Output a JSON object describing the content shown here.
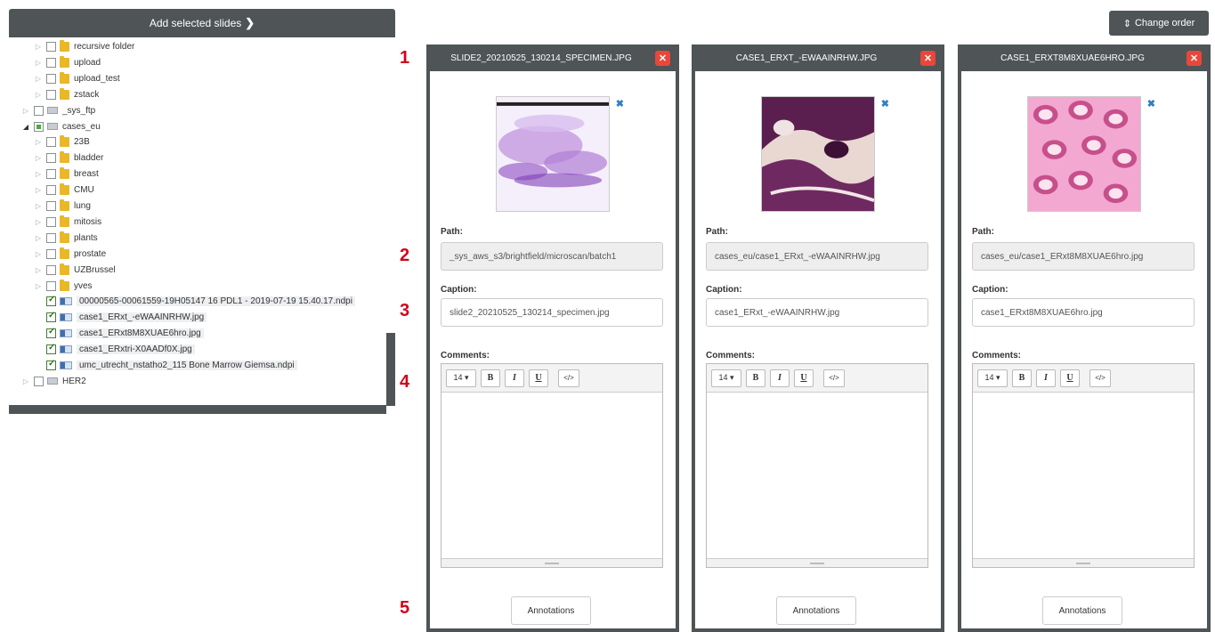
{
  "add_button": {
    "label": "Add selected slides",
    "icon": "chevron-right-icon"
  },
  "change_order": {
    "label": "Change order",
    "icon": "sort-icon"
  },
  "tree": [
    {
      "label": "recursive folder",
      "kind": "folder",
      "level": 2,
      "checked": "no",
      "toggle": "closed"
    },
    {
      "label": "upload",
      "kind": "folder",
      "level": 2,
      "checked": "no",
      "toggle": "closed"
    },
    {
      "label": "upload_test",
      "kind": "folder",
      "level": 2,
      "checked": "no",
      "toggle": "closed"
    },
    {
      "label": "zstack",
      "kind": "folder",
      "level": 2,
      "checked": "no",
      "toggle": "closed"
    },
    {
      "label": "_sys_ftp",
      "kind": "drive",
      "level": 1,
      "checked": "no",
      "toggle": "closed"
    },
    {
      "label": "cases_eu",
      "kind": "drive",
      "level": 1,
      "checked": "partial",
      "toggle": "open"
    },
    {
      "label": "23B",
      "kind": "folder",
      "level": 2,
      "checked": "no",
      "toggle": "closed"
    },
    {
      "label": "bladder",
      "kind": "folder",
      "level": 2,
      "checked": "no",
      "toggle": "closed"
    },
    {
      "label": "breast",
      "kind": "folder",
      "level": 2,
      "checked": "no",
      "toggle": "closed"
    },
    {
      "label": "CMU",
      "kind": "folder",
      "level": 2,
      "checked": "no",
      "toggle": "closed"
    },
    {
      "label": "lung",
      "kind": "folder",
      "level": 2,
      "checked": "no",
      "toggle": "closed"
    },
    {
      "label": "mitosis",
      "kind": "folder",
      "level": 2,
      "checked": "no",
      "toggle": "closed"
    },
    {
      "label": "plants",
      "kind": "folder",
      "level": 2,
      "checked": "no",
      "toggle": "closed"
    },
    {
      "label": "prostate",
      "kind": "folder",
      "level": 2,
      "checked": "no",
      "toggle": "closed"
    },
    {
      "label": "UZBrussel",
      "kind": "folder",
      "level": 2,
      "checked": "no",
      "toggle": "closed"
    },
    {
      "label": "yves",
      "kind": "folder",
      "level": 2,
      "checked": "no",
      "toggle": "closed"
    },
    {
      "label": "00000565-00061559-19H05147 16 PDL1 - 2019-07-19 15.40.17.ndpi",
      "kind": "slide",
      "level": 2,
      "checked": "yes",
      "toggle": "none"
    },
    {
      "label": "case1_ERxt_-eWAAINRHW.jpg",
      "kind": "slide",
      "level": 2,
      "checked": "yes",
      "toggle": "none"
    },
    {
      "label": "case1_ERxt8M8XUAE6hro.jpg",
      "kind": "slide",
      "level": 2,
      "checked": "yes",
      "toggle": "none"
    },
    {
      "label": "case1_ERxtri-X0AADf0X.jpg",
      "kind": "slide",
      "level": 2,
      "checked": "yes",
      "toggle": "none"
    },
    {
      "label": "umc_utrecht_nstatho2_115 Bone Marrow Giemsa.ndpi",
      "kind": "slide",
      "level": 2,
      "checked": "yes",
      "toggle": "none"
    },
    {
      "label": "HER2",
      "kind": "drive",
      "level": 1,
      "checked": "no",
      "toggle": "closed"
    }
  ],
  "steps": [
    "1",
    "2",
    "3",
    "4",
    "5"
  ],
  "labels": {
    "path": "Path:",
    "caption": "Caption:",
    "comments": "Comments:",
    "annotations": "Annotations"
  },
  "toolbar": {
    "size": "14 ▾",
    "bold": "B",
    "italic": "I",
    "underline": "U",
    "code": "</>"
  },
  "cards": [
    {
      "title": "SLIDE2_20210525_130214_SPECIMEN.JPG",
      "path": "_sys_aws_s3/brightfield/microscan/batch1",
      "caption": "slide2_20210525_130214_specimen.jpg",
      "thumb": "giemsa-specimen"
    },
    {
      "title": "CASE1_ERXT_-EWAAINRHW.JPG",
      "path": "cases_eu/case1_ERxt_-eWAAINRHW.jpg",
      "caption": "case1_ERxt_-eWAAINRHW.jpg",
      "thumb": "he-tissue-dark"
    },
    {
      "title": "CASE1_ERXT8M8XUAE6HRO.JPG",
      "path": "cases_eu/case1_ERxt8M8XUAE6hro.jpg",
      "caption": "case1_ERxt8M8XUAE6hro.jpg",
      "thumb": "he-tissue-pink"
    }
  ],
  "colors": {
    "dark": "#4f5456",
    "close_red": "#e8473a",
    "step_red": "#d0021b",
    "link_blue": "#2f7fc1"
  }
}
